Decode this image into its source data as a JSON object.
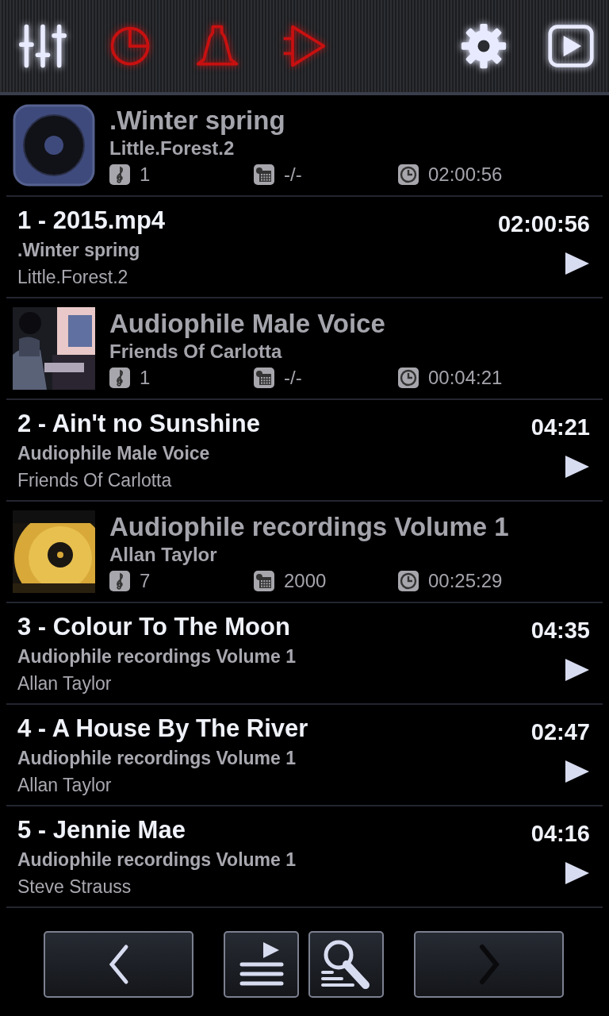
{
  "toolbar": {
    "left": [
      {
        "kind": "equalizer",
        "color": "#e8eaff"
      },
      {
        "kind": "timer",
        "color": "#c81010"
      },
      {
        "kind": "alarm",
        "color": "#c81010"
      },
      {
        "kind": "output",
        "color": "#c81010"
      }
    ],
    "right": [
      {
        "kind": "settings",
        "color": "#e8eaff"
      },
      {
        "kind": "player",
        "color": "#e8eaff"
      }
    ]
  },
  "list": [
    {
      "kind": "album",
      "cover": {
        "kind": "disc"
      },
      "title": ".Winter spring",
      "artist": "Little.Forest.2",
      "tracks": "1",
      "year": "-/-",
      "duration": "02:00:56"
    },
    {
      "kind": "track",
      "title": "1 - 2015.mp4",
      "album": ".Winter spring",
      "artist": "Little.Forest.2",
      "duration": "02:00:56"
    },
    {
      "kind": "album",
      "title": "Audiophile Male Voice",
      "artist": "Friends Of Carlotta",
      "tracks": "1",
      "year": "-/-",
      "duration": "00:04:21"
    },
    {
      "kind": "track",
      "title": "2 - Ain't no Sunshine",
      "album": "Audiophile Male Voice",
      "artist": "Friends Of Carlotta",
      "duration": "04:21"
    },
    {
      "kind": "album",
      "title": "Audiophile recordings Volume 1",
      "artist": "Allan Taylor",
      "tracks": "7",
      "year": "2000",
      "duration": "00:25:29"
    },
    {
      "kind": "track",
      "title": "3 - Colour To The Moon",
      "album": "Audiophile recordings Volume 1",
      "artist": "Allan Taylor",
      "duration": "04:35"
    },
    {
      "kind": "track",
      "title": "4 - A House By The River",
      "album": "Audiophile recordings Volume 1",
      "artist": "Allan Taylor",
      "duration": "02:47"
    },
    {
      "kind": "track",
      "title": "5 - Jennie Mae",
      "album": "Audiophile recordings Volume 1",
      "artist": "Steve Strauss",
      "duration": "04:16"
    }
  ],
  "nav": [
    {
      "kind": "previous"
    },
    {
      "kind": "queue"
    },
    {
      "kind": "search"
    },
    {
      "kind": "next"
    }
  ]
}
